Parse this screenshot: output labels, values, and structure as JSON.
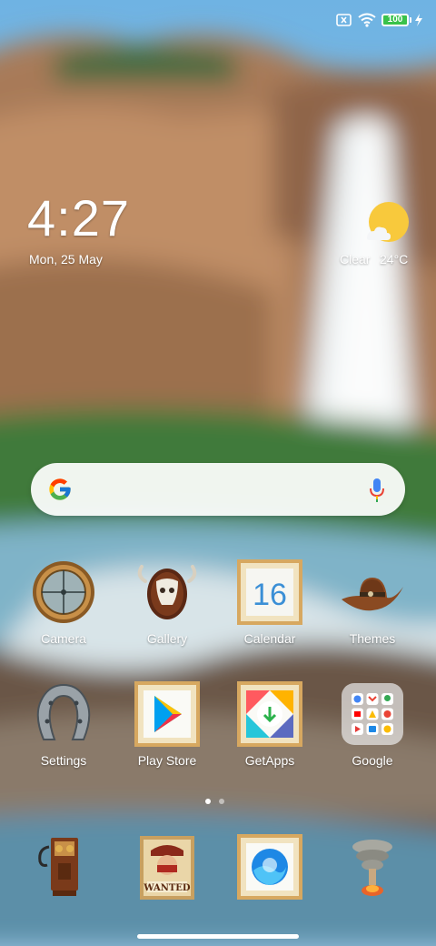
{
  "status_bar": {
    "battery_level": "100",
    "battery_fraction": 1.0,
    "icons": [
      "sim-x-icon",
      "wifi-icon",
      "battery-icon",
      "charging-icon"
    ]
  },
  "clock_widget": {
    "time": "4:27",
    "date": "Mon, 25 May"
  },
  "weather_widget": {
    "condition": "Clear",
    "temperature": "24°C",
    "icon": "sun-cloud-icon"
  },
  "search_widget": {
    "logo_icon": "google-g-icon",
    "mic_icon": "mic-icon"
  },
  "apps_row1": [
    {
      "label": "Camera",
      "icon": "camera-icon"
    },
    {
      "label": "Gallery",
      "icon": "gallery-icon"
    },
    {
      "label": "Calendar",
      "icon": "calendar-icon",
      "day": "16"
    },
    {
      "label": "Themes",
      "icon": "themes-icon"
    }
  ],
  "apps_row2": [
    {
      "label": "Settings",
      "icon": "settings-icon"
    },
    {
      "label": "Play Store",
      "icon": "play-store-icon"
    },
    {
      "label": "GetApps",
      "icon": "getapps-icon"
    },
    {
      "label": "Google",
      "icon": "google-folder-icon"
    }
  ],
  "dock": [
    {
      "icon": "phone-icon"
    },
    {
      "icon": "messages-icon",
      "sign_text": "WANTED"
    },
    {
      "icon": "browser-icon"
    },
    {
      "icon": "security-icon"
    }
  ],
  "pager": {
    "pages": 2,
    "current": 1
  },
  "colors": {
    "battery_green": "#39c24a",
    "sky": "#5aa0d8",
    "cliff": "#b8845c",
    "forest": "#3f7a3a",
    "water": "#8cbfd4"
  }
}
